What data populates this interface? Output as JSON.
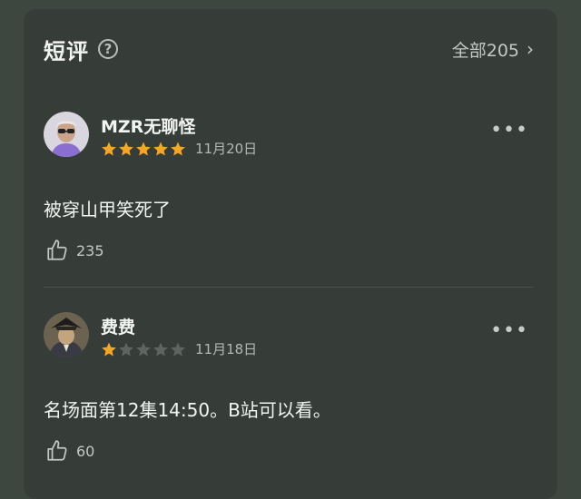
{
  "section": {
    "title": "短评",
    "help_icon": "help-circle-icon",
    "all_label": "全部205"
  },
  "reviews": [
    {
      "name": "MZR无聊怪",
      "rating": 5,
      "max_rating": 5,
      "date": "11月20日",
      "text": "被穿山甲笑死了",
      "likes": "235"
    },
    {
      "name": "费费",
      "rating": 1,
      "max_rating": 5,
      "date": "11月18日",
      "text": "名场面第12集14:50。B站可以看。",
      "likes": "60"
    }
  ],
  "colors": {
    "star_on": "#f5a623",
    "star_off": "#5e645f",
    "background": "#3e4640",
    "card": "#363d38"
  }
}
